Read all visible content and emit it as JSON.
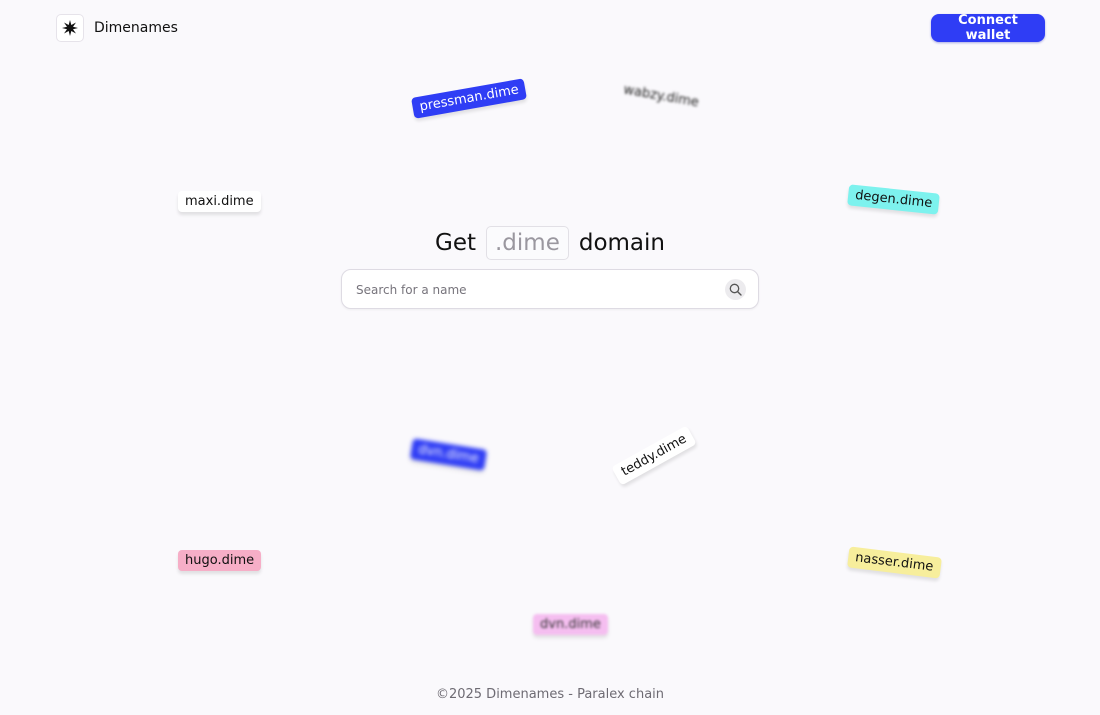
{
  "header": {
    "brand": "Dimenames",
    "connect_label": "Connect wallet"
  },
  "hero": {
    "prefix": "Get",
    "tld": ".dime",
    "suffix": "domain"
  },
  "search": {
    "placeholder": "Search for a name",
    "value": ""
  },
  "tags": {
    "pressman": "pressman.dime",
    "wabzy": "wabzy.dime",
    "maxi": "maxi.dime",
    "degen": "degen.dime",
    "dvn_blue": "dvn.dime",
    "teddy": "teddy.dime",
    "hugo": "hugo.dime",
    "nasser": "nasser.dime",
    "dvn_pink": "dvn.dime"
  },
  "footer": {
    "text": "©2025 Dimenames - Paralex chain"
  },
  "colors": {
    "accent": "#2f3df5",
    "background": "#faf9fc",
    "tag_cyan": "#7df2ee",
    "tag_pink": "#f6aec7",
    "tag_yellow": "#f7ee9c",
    "tag_magenta": "#f5bef0"
  },
  "icons": {
    "logo": "sparkle-star-icon",
    "search": "search-icon"
  }
}
